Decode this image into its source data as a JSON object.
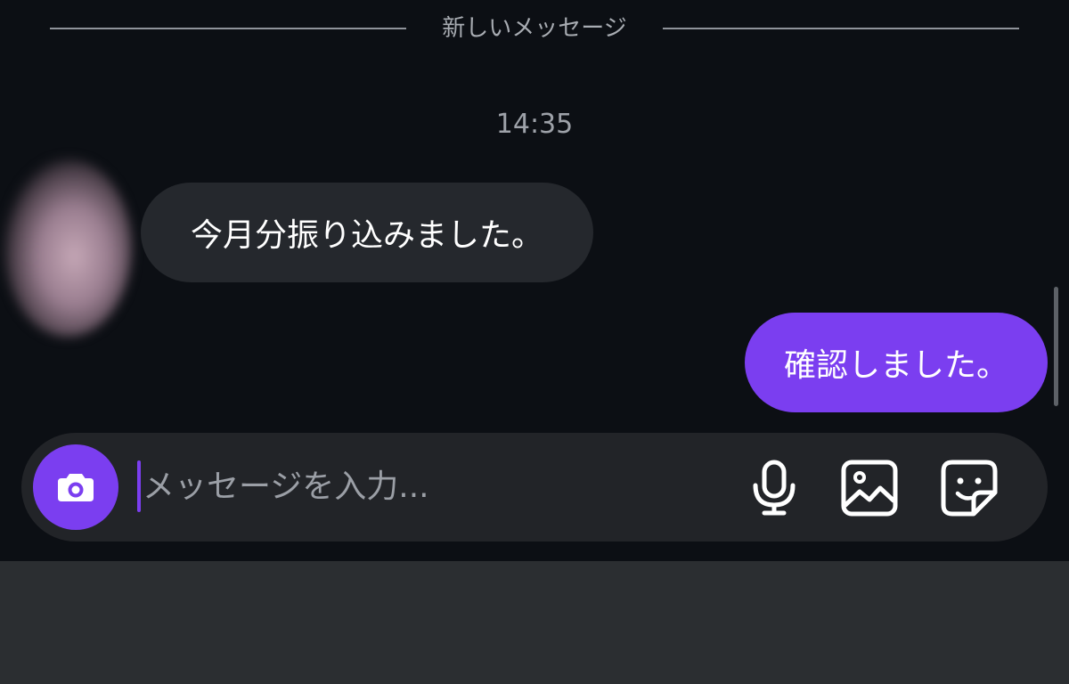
{
  "chat": {
    "divider_label": "新しいメッセージ",
    "timestamp": "14:35",
    "messages": [
      {
        "direction": "incoming",
        "text": "今月分振り込みました。"
      },
      {
        "direction": "outgoing",
        "text": "確認しました。"
      }
    ]
  },
  "composer": {
    "placeholder": "メッセージを入力...",
    "value": "",
    "icons": {
      "camera": "camera-icon",
      "mic": "microphone-icon",
      "gallery": "image-icon",
      "sticker": "sticker-icon"
    }
  },
  "colors": {
    "background": "#0c0f14",
    "accent": "#7b3ef0",
    "incoming_bubble": "#25282d",
    "composer": "#222428",
    "bottom_panel": "#2b2e31"
  }
}
